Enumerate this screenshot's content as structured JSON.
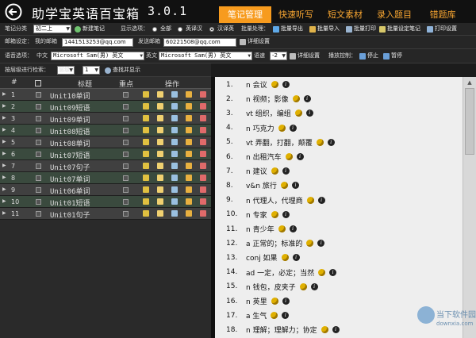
{
  "titlebar": {
    "title": "助学宝英语百宝箱",
    "version": "3.0.1"
  },
  "tabs": [
    {
      "label": "笔记管理",
      "active": true
    },
    {
      "label": "快速听写",
      "active": false
    },
    {
      "label": "短文素材",
      "active": false
    },
    {
      "label": "录入题目",
      "active": false
    },
    {
      "label": "错题库",
      "active": false
    }
  ],
  "toolbar1": {
    "category_label": "笔记分类",
    "category_value": "初二上",
    "new_note": "新建笔记",
    "display_label": "显示选项：",
    "opt_all": "全部",
    "opt_en_zh": "英译汉",
    "opt_zh_en": "汉译英",
    "batch_label": "批量处理：",
    "export": "批量导出",
    "import": "批量导入",
    "print": "批量打印",
    "batch_set": "批量设定笔记",
    "print_setup": "打印设置"
  },
  "toolbar2": {
    "mail_label": "邮箱设定：",
    "from_label": "我的邮箱",
    "from_value": "1441513253@qq.com",
    "to_label": "发送邮箱",
    "to_value": "60221508@qq.com",
    "detail": "详细设置"
  },
  "toolbar3": {
    "voice_label": "语音选项：",
    "zh_label": "中文",
    "zh_voice": "Microsoft Sam(男) 英文",
    "en_label": "英文",
    "en_voice": "Microsoft Sam(男) 英文",
    "speed_label": "语速",
    "speed_value": "-2",
    "detail": "详细设置",
    "play_label": "播放控制：",
    "stop": "停止",
    "pause": "暂停"
  },
  "toolbar4": {
    "search_label": "按层级进行检索：",
    "level_label": "层级",
    "level_value": "1",
    "find": "查找并显示"
  },
  "table": {
    "headers": {
      "num": "#",
      "title": "标题",
      "key": "重点",
      "ops": "操作"
    },
    "rows": [
      {
        "n": "1",
        "title": "Unit10单词"
      },
      {
        "n": "2",
        "title": "Unit09短语"
      },
      {
        "n": "3",
        "title": "Unit09单词"
      },
      {
        "n": "4",
        "title": "Unit08短语"
      },
      {
        "n": "5",
        "title": "Unit08单词"
      },
      {
        "n": "6",
        "title": "Unit07短语"
      },
      {
        "n": "7",
        "title": "Unit07句子"
      },
      {
        "n": "8",
        "title": "Unit07单词"
      },
      {
        "n": "9",
        "title": "Unit06单词"
      },
      {
        "n": "10",
        "title": "Unit01短语"
      },
      {
        "n": "11",
        "title": "Unit01句子"
      }
    ]
  },
  "notes": [
    {
      "num": "1.",
      "text": "n  会议"
    },
    {
      "num": "2.",
      "text": "n  视频；影像"
    },
    {
      "num": "3.",
      "text": "vt  组织，编组"
    },
    {
      "num": "4.",
      "text": "n  巧克力"
    },
    {
      "num": "5.",
      "text": "vt  弄翻，打翻，颠覆"
    },
    {
      "num": "6.",
      "text": "n  出租汽车"
    },
    {
      "num": "7.",
      "text": "n  建议"
    },
    {
      "num": "8.",
      "text": "v&n  旅行"
    },
    {
      "num": "9.",
      "text": "n  代理人，代理商"
    },
    {
      "num": "10.",
      "text": "n  专家"
    },
    {
      "num": "11.",
      "text": "n  青少年"
    },
    {
      "num": "12.",
      "text": "a  正常的；标准的"
    },
    {
      "num": "13.",
      "text": "conj  如果"
    },
    {
      "num": "14.",
      "text": "ad  一定，必定；当然"
    },
    {
      "num": "15.",
      "text": "n  钱包，皮夹子"
    },
    {
      "num": "16.",
      "text": "n  英里"
    },
    {
      "num": "17.",
      "text": "a  生气"
    },
    {
      "num": "18.",
      "text": "n  理解；理解力；协定"
    },
    {
      "num": "19.",
      "text": "a  粗心的；粗心大意"
    }
  ],
  "watermark": {
    "name": "当下软件园",
    "url": "downxia.com"
  },
  "colors": {
    "accent": "#f79b1e",
    "tab_text": "#f7a531",
    "row_odd": "#404040",
    "row_even": "#3a4a3e",
    "notes_bg": "#eeeeee"
  }
}
